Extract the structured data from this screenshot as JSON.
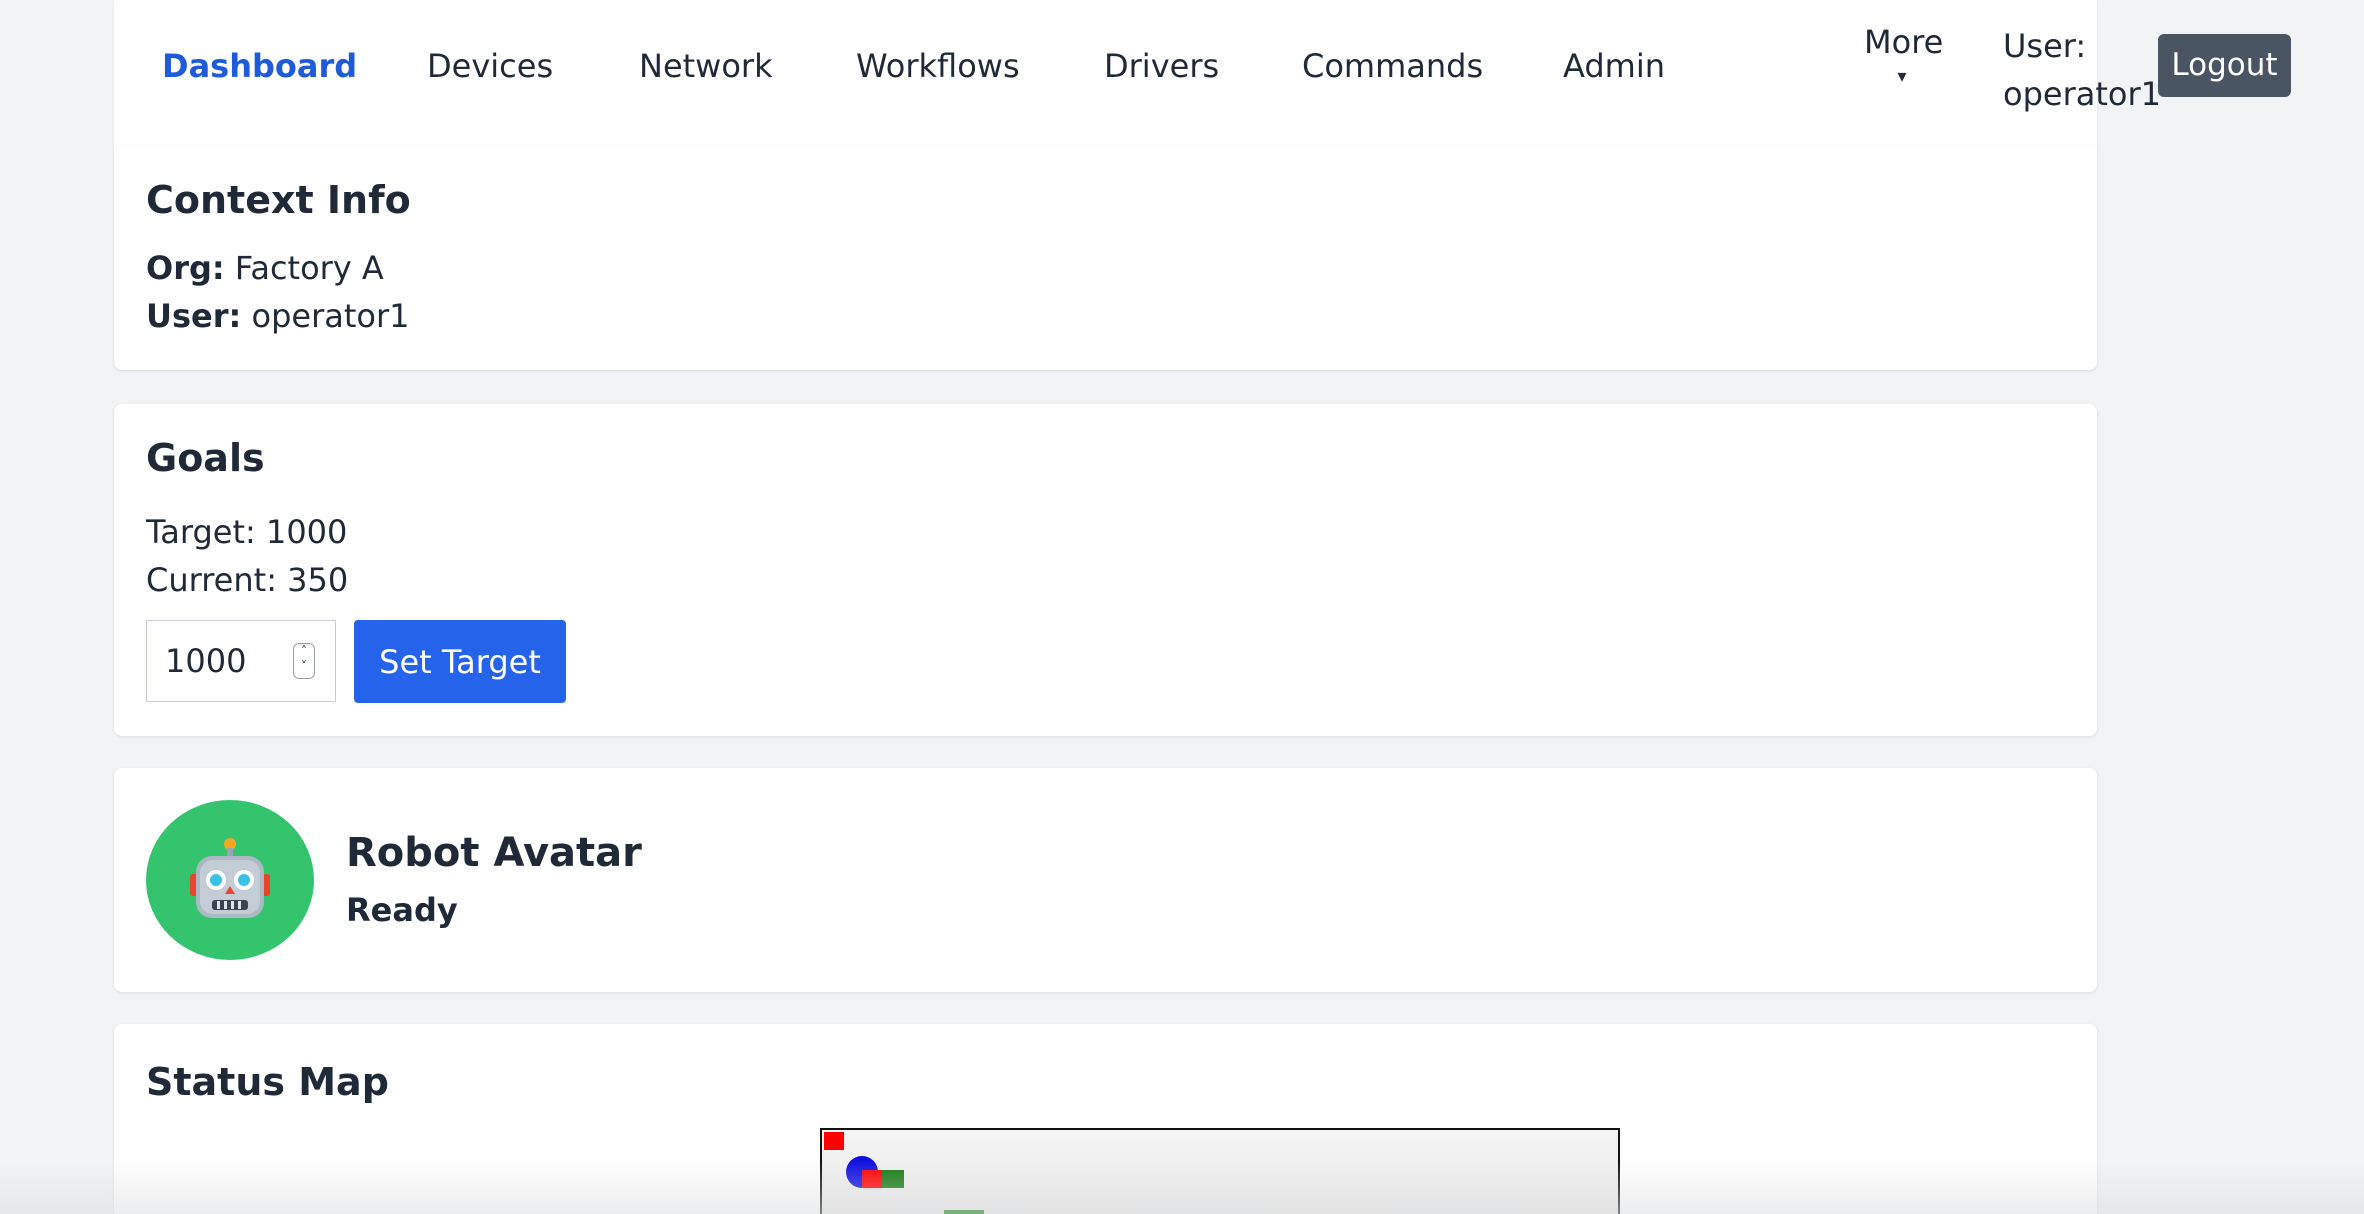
{
  "nav": {
    "items": [
      {
        "label": "Dashboard",
        "active": true
      },
      {
        "label": "Devices"
      },
      {
        "label": "Network"
      },
      {
        "label": "Workflows"
      },
      {
        "label": "Drivers"
      },
      {
        "label": "Commands"
      },
      {
        "label": "Admin"
      }
    ],
    "more_label": "More",
    "more_caret": "▾",
    "user_text": "User: operator1",
    "logout_label": "Logout",
    "accent_color": "#1d5bd8"
  },
  "context": {
    "title": "Context Info",
    "org_label": "Org:",
    "org_value": "Factory A",
    "user_label": "User:",
    "user_value": "operator1"
  },
  "goals": {
    "title": "Goals",
    "target_text": "Target: 1000",
    "current_text": "Current: 350",
    "input_value": "1000",
    "set_target_label": "Set Target",
    "button_color": "#2563eb"
  },
  "robot": {
    "name": "Robot Avatar",
    "status": "Ready",
    "avatar_icon": "robot-face-icon",
    "avatar_color": "#34c46e"
  },
  "status_map": {
    "title": "Status Map",
    "markers": [
      {
        "shape": "square",
        "color": "#ff0000"
      },
      {
        "shape": "circle",
        "color": "#1010e0"
      },
      {
        "shape": "square",
        "color": "#ff0000"
      },
      {
        "shape": "square",
        "color": "#137a13"
      },
      {
        "shape": "square",
        "color": "#137a13"
      }
    ]
  }
}
